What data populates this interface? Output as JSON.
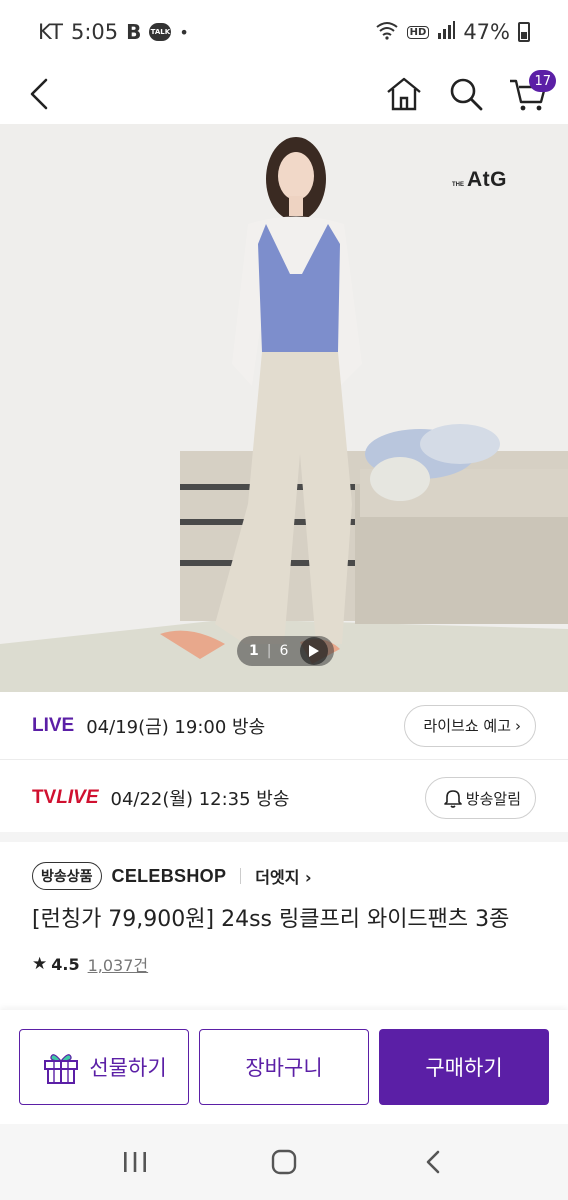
{
  "status_bar": {
    "carrier": "KT",
    "time": "5:05",
    "b_glyph": "B",
    "talk_label": "TALK",
    "dot": "•",
    "hd_label": "HD",
    "battery": "47%",
    "icons": [
      "b-icon",
      "kakaotalk-icon",
      "wifi-icon",
      "hd-icon",
      "signal-icon",
      "battery-icon"
    ]
  },
  "top_nav": {
    "icons": [
      "back-arrow-icon",
      "home-icon",
      "search-icon",
      "cart-icon"
    ],
    "cart_count": "17",
    "accent_color": "#5b1fa6"
  },
  "product_image": {
    "brand_logo_small": "THE",
    "brand_logo": "AtG",
    "current_index": "1",
    "separator": "|",
    "total": "6",
    "play_icon": "play-icon"
  },
  "broadcast": {
    "live": {
      "tag": "LIVE",
      "schedule": "04/19(금) 19:00 방송",
      "button_label": "라이브쇼 예고",
      "button_chevron": "›"
    },
    "tvlive": {
      "tag_tv": "TV",
      "tag_live": "LIVE",
      "schedule": "04/22(월) 12:35 방송",
      "button_label": "방송알림",
      "button_icon": "bell-icon"
    }
  },
  "product": {
    "badge": "방송상품",
    "shop": "CELEBSHOP",
    "brand_link": "더엣지 ›",
    "title": "[런칭가 79,900원] 24ss 링클프리 와이드팬츠 3종",
    "rating_star": "★",
    "rating": "4.5",
    "review_count": "1,037건"
  },
  "actions": {
    "gift_label": "선물하기",
    "gift_icon": "gift-icon",
    "cart_label": "장바구니",
    "buy_label": "구매하기"
  },
  "system_nav": {
    "icons": [
      "recent-apps-icon",
      "home-button-icon",
      "back-icon"
    ]
  }
}
